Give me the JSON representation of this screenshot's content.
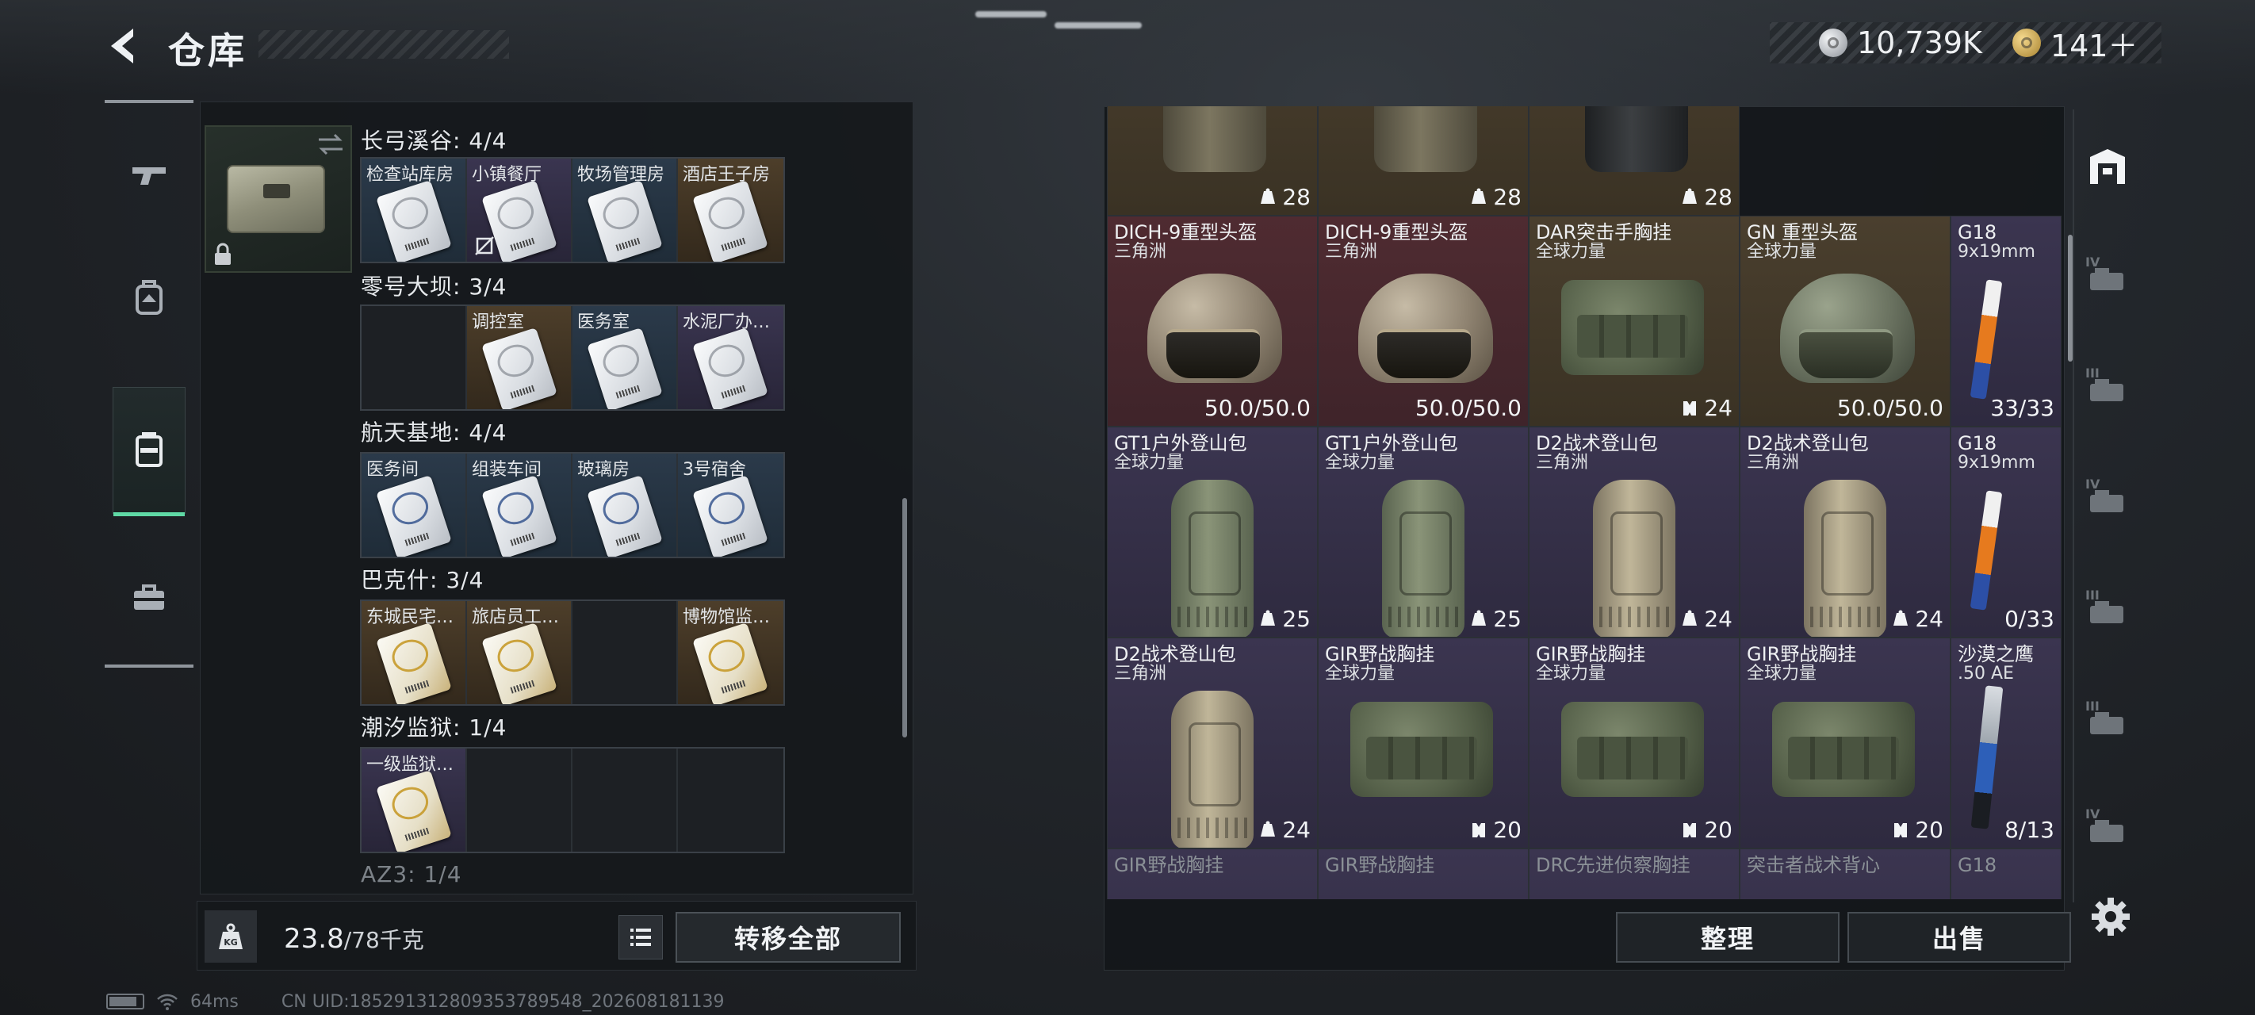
{
  "header": {
    "title": "仓库",
    "currency_silver": "10,739K",
    "currency_gold": "141＋"
  },
  "safebox": {
    "regions": [
      {
        "title": "长弓溪谷: 4/4",
        "slots": [
          {
            "name": "检查站库房",
            "bg": "blue",
            "card": "plain"
          },
          {
            "name": "小镇餐厅",
            "bg": "purple",
            "card": "plain",
            "mark": true
          },
          {
            "name": "牧场管理房",
            "bg": "blue",
            "card": "plain"
          },
          {
            "name": "酒店王子房",
            "bg": "gold",
            "card": "plain"
          }
        ]
      },
      {
        "title": "零号大坝: 3/4",
        "slots": [
          {
            "name": "",
            "bg": "empty",
            "card": "none"
          },
          {
            "name": "调控室",
            "bg": "gold",
            "card": "plain"
          },
          {
            "name": "医务室",
            "bg": "blue",
            "card": "plain"
          },
          {
            "name": "水泥厂办…",
            "bg": "purple",
            "card": "plain"
          }
        ]
      },
      {
        "title": "航天基地: 4/4",
        "slots": [
          {
            "name": "医务间",
            "bg": "blue",
            "card": "blue"
          },
          {
            "name": "组装车间",
            "bg": "blue",
            "card": "blue"
          },
          {
            "name": "玻璃房",
            "bg": "blue",
            "card": "blue"
          },
          {
            "name": "3号宿舍",
            "bg": "blue",
            "card": "blue"
          }
        ]
      },
      {
        "title": "巴克什: 3/4",
        "slots": [
          {
            "name": "东城民宅…",
            "bg": "gold",
            "card": "gold"
          },
          {
            "name": "旅店员工…",
            "bg": "gold",
            "card": "gold"
          },
          {
            "name": "",
            "bg": "empty",
            "card": "none"
          },
          {
            "name": "博物馆监…",
            "bg": "gold",
            "card": "gold"
          }
        ]
      },
      {
        "title": "潮汐监狱: 1/4",
        "slots": [
          {
            "name": "一级监狱…",
            "bg": "purple",
            "card": "gold"
          },
          {
            "name": "",
            "bg": "empty",
            "card": "none"
          },
          {
            "name": "",
            "bg": "empty",
            "card": "none"
          },
          {
            "name": "",
            "bg": "empty",
            "card": "none"
          }
        ]
      }
    ],
    "next_region_title": "AZ3: 1/4"
  },
  "weight": {
    "current": "23.8",
    "capacity": "/78千克",
    "kg_label": "KG"
  },
  "buttons": {
    "transfer_all": "转移全部",
    "sort": "整理",
    "sell": "出售"
  },
  "status": {
    "ping": "64ms",
    "uid": "CN UID:1852913128093537895​48_202608181139"
  },
  "items": {
    "row0": [
      {
        "value": "28",
        "rarity": "gold",
        "art": "vest"
      },
      {
        "value": "28",
        "rarity": "gold",
        "art": "vest"
      },
      {
        "value": "28",
        "rarity": "gold",
        "art": "vest-black"
      }
    ],
    "row1": [
      {
        "name": "DICH-9重型头盔",
        "sub": "三角洲",
        "value": "50.0/50.0",
        "rarity": "red",
        "art": "helmet"
      },
      {
        "name": "DICH-9重型头盔",
        "sub": "三角洲",
        "value": "50.0/50.0",
        "rarity": "red",
        "art": "helmet"
      },
      {
        "name": "DAR突击手胸挂",
        "sub": "全球力量",
        "value": "24",
        "rarity": "gold",
        "art": "bag",
        "icon": "vest"
      },
      {
        "name": "GN 重型头盔",
        "sub": "全球力量",
        "value": "50.0/50.0",
        "rarity": "gold",
        "art": "helmet-gn"
      },
      {
        "name": "G18",
        "sub": "9x19mm",
        "value": "33/33",
        "rarity": "purple",
        "art": "pistol"
      }
    ],
    "row2": [
      {
        "name": "GT1户外登山包",
        "sub": "全球力量",
        "value": "25",
        "rarity": "purple",
        "art": "pack"
      },
      {
        "name": "GT1户外登山包",
        "sub": "全球力量",
        "value": "25",
        "rarity": "purple",
        "art": "pack"
      },
      {
        "name": "D2战术登山包",
        "sub": "三角洲",
        "value": "24",
        "rarity": "purple",
        "art": "pack-tan"
      },
      {
        "name": "D2战术登山包",
        "sub": "三角洲",
        "value": "24",
        "rarity": "purple",
        "art": "pack-tan"
      },
      {
        "name": "G18",
        "sub": "9x19mm",
        "value": "0/33",
        "rarity": "purple",
        "art": "pistol"
      }
    ],
    "row3": [
      {
        "name": "D2战术登山包",
        "sub": "三角洲",
        "value": "24",
        "rarity": "purple",
        "art": "pack-tan"
      },
      {
        "name": "GIR野战胸挂",
        "sub": "全球力量",
        "value": "20",
        "rarity": "purple",
        "art": "bag",
        "icon": "vest"
      },
      {
        "name": "GIR野战胸挂",
        "sub": "全球力量",
        "value": "20",
        "rarity": "purple",
        "art": "bag",
        "icon": "vest"
      },
      {
        "name": "GIR野战胸挂",
        "sub": "全球力量",
        "value": "20",
        "rarity": "purple",
        "art": "bag",
        "icon": "vest"
      },
      {
        "name": "沙漠之鹰",
        "sub": ".50 AE",
        "value": "8/13",
        "rarity": "purple",
        "art": "deagle"
      }
    ],
    "row4": [
      {
        "name": "GIR野战胸挂",
        "rarity": "purple"
      },
      {
        "name": "GIR野战胸挂",
        "rarity": "purple"
      },
      {
        "name": "DRC先进侦察胸挂",
        "rarity": "purple"
      },
      {
        "name": "突击者战术背心",
        "rarity": "purple"
      },
      {
        "name": "G18",
        "rarity": "purple"
      }
    ]
  },
  "sidebar_right_tabs": [
    "IV",
    "III",
    "IV",
    "III",
    "III",
    "IV"
  ],
  "colors": {
    "accent_green": "#5fd9a5",
    "rarity_gold": "#4a3f2e",
    "rarity_red": "#4f2b31",
    "rarity_purple": "#3b3550",
    "rarity_blue": "#2b3a4a"
  }
}
